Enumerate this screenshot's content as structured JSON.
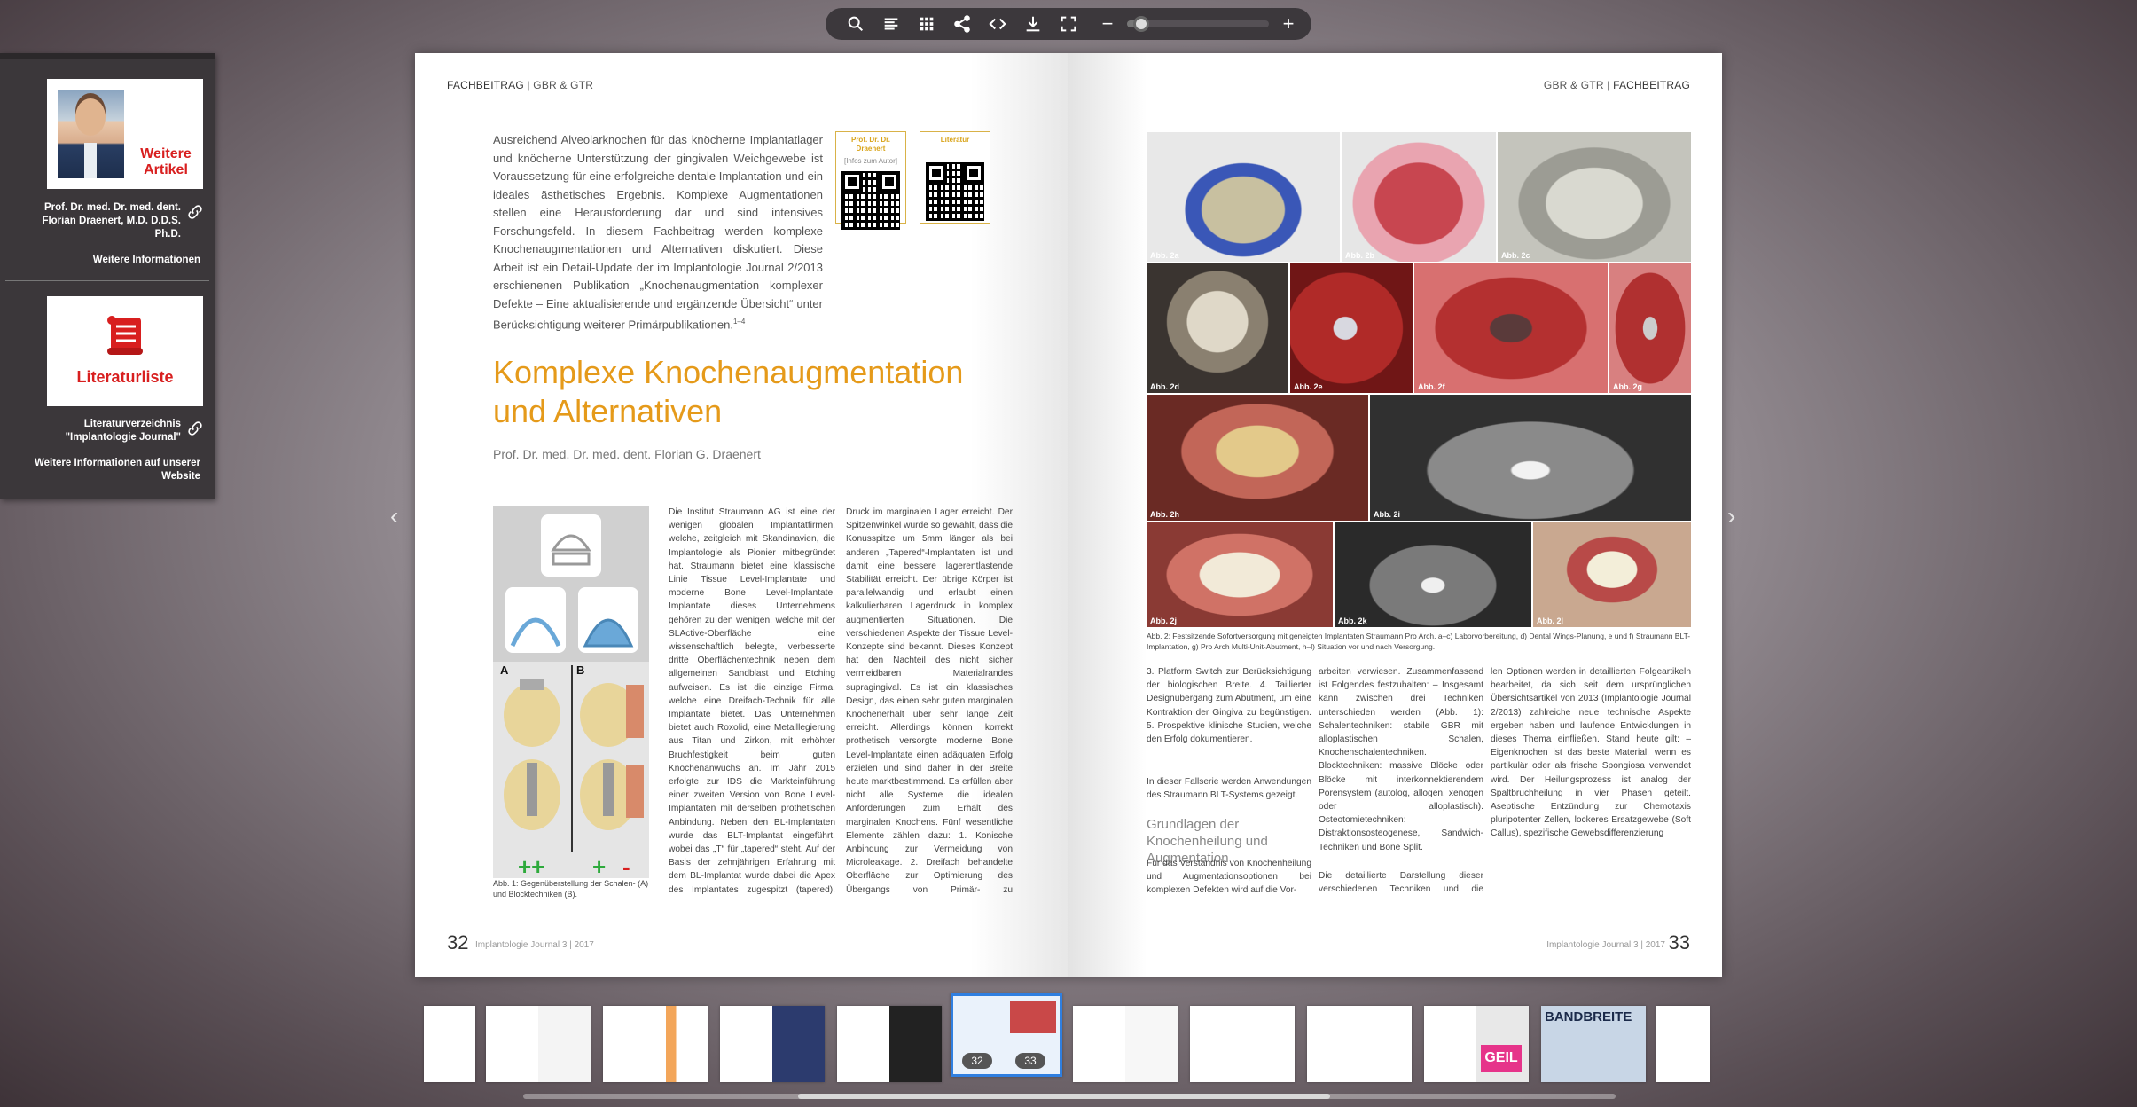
{
  "toolbar": {
    "icons": [
      "search-icon",
      "toc-icon",
      "grid-icon",
      "share-icon",
      "embed-icon",
      "download-icon",
      "fullscreen-icon"
    ],
    "zoom_minus": "−",
    "zoom_plus": "+",
    "zoom_level": 0.1
  },
  "sidebar": {
    "card1_title": "Weitere Artikel",
    "author_name": "Prof. Dr. med. Dr. med. dent. Florian Draenert, M.D. D.D.S. Ph.D.",
    "more_info": "Weitere Informationen",
    "card2_title": "Literaturliste",
    "lit_link": "Literaturverzeichnis \"Implantologie Journal\"",
    "website_link": "Weitere Informationen auf unserer Website"
  },
  "left_page": {
    "runhead_section": "FACHBEITRAG",
    "runhead_topic": "GBR & GTR",
    "intro": "Ausreichend Alveolarknochen für das knöcherne Implantatlager und knöcherne Unterstützung der gingivalen Weichgewebe ist Voraussetzung für eine erfolgreiche dentale Implantation und ein ideales ästhetisches Ergebnis. Komplexe Augmentationen stellen eine Herausforderung dar und sind intensives Forschungsfeld. In diesem Fachbeitrag werden komplexe Knochenaugmentationen und Alternativen diskutiert. Diese Arbeit ist ein Detail-Update der im Implantologie Journal 2/2013 erschienenen Publikation „Knochenaugmentation komplexer Defekte – Eine aktualisierende und ergänzende Übersicht“ unter Berücksichtigung weiterer Primärpublikationen.",
    "intro_ref": "1–4",
    "qr1_label": "Prof. Dr. Dr. Draenert",
    "qr1_sub": "[Infos zum Autor]",
    "qr2_label": "Literatur",
    "title": "Komplexe Knochenaugmentation und Alternativen",
    "author": "Prof. Dr. med. Dr. med. dent. Florian G. Draenert",
    "fig_label_a": "A",
    "fig_label_b": "B",
    "fig_plusplus": "++",
    "fig_plus": "+",
    "fig_minus": "-",
    "fig_caption": "Abb. 1: Gegenüberstellung der Schalen- (A) und Blocktechniken (B).",
    "col1": "Die Institut Straumann AG ist eine der wenigen globalen Implantatfirmen, welche, zeitgleich mit Skandinavien, die Implantologie als Pionier mitbegründet hat. Straumann bietet eine klassische Linie Tissue Level-Implantate und moderne Bone Level-Implantate. Implantate dieses Unternehmens gehören zu den wenigen, welche mit der SLActive-Oberfläche eine wissenschaftlich belegte, verbesserte dritte Oberflächentechnik neben dem allgemeinen Sandblast und Etching aufweisen. Es ist die einzige Firma, welche eine Dreifach-Technik für alle Implantate bietet. Das Unternehmen bietet auch Roxolid, eine Metalllegierung aus Titan und Zirkon, mit erhöhter Bruchfestigkeit beim guten Knochenanwuchs an. Im Jahr 2015 erfolgte zur IDS die Markteinführung einer zweiten Version von Bone Level-Implantaten mit derselben prothetischen Anbindung. Neben den BL-Implantaten wurde das BLT-Implantat eingeführt, wobei das „T“ für „tapered“ steht. Auf der Basis der zehnjährigen Erfahrung mit dem BL-Implantat wurde dabei die Apex des Implantates zugespitzt (tapered), was eine erhöhte Primärstabilität ohne erhöhten",
    "col2": "Druck im marginalen Lager erreicht. Der Spitzenwinkel wurde so gewählt, dass die Konusspitze um 5mm länger als bei anderen „Tapered“-Implantaten ist und damit eine bessere lagerentlastende Stabilität erreicht. Der übrige Körper ist parallelwandig und erlaubt einen kalkulierbaren Lagerdruck in komplex augmentierten Situationen. Die verschiedenen Aspekte der Tissue Level-Konzepte sind bekannt. Dieses Konzept hat den Nachteil des nicht sicher vermeidbaren Materialrandes supragingival. Es ist ein klassisches Design, das einen sehr guten marginalen Knochenerhalt über sehr lange Zeit erreicht. Allerdings können korrekt prothetisch versorgte moderne Bone Level-Implantate einen adäquaten Erfolg erzielen und sind daher in der Breite heute marktbestimmend. Es erfüllen aber nicht alle Systeme die idealen Anforderungen zum Erhalt des marginalen Knochens. Fünf wesentliche Elemente zählen dazu: 1. Konische Anbindung zur Vermeidung von Microleakage. 2. Dreifach behandelte Oberfläche zur Optimierung des Übergangs von Primär- zu Sekundärstabilität.",
    "page_number": "32",
    "footer": "Implantologie Journal 3 | 2017"
  },
  "right_page": {
    "runhead_topic": "GBR & GTR",
    "runhead_section": "FACHBEITRAG",
    "photos": [
      "Abb. 2a",
      "Abb. 2b",
      "Abb. 2c",
      "Abb. 2d",
      "Abb. 2e",
      "Abb. 2f",
      "Abb. 2g",
      "Abb. 2h",
      "Abb. 2i",
      "Abb. 2j",
      "Abb. 2k",
      "Abb. 2l"
    ],
    "fig_caption": "Abb. 2: Festsitzende Sofortversorgung mit geneigten Implantaten Straumann Pro Arch. a–c) Laborvorbereitung, d) Dental Wings-Planung, e und f) Straumann BLT-Implantation, g) Pro Arch Multi-Unit-Abutment, h–l) Situation vor und nach Versorgung.",
    "col1a": "3. Platform Switch zur Berücksichtigung der biologischen Breite. 4. Taillierter Designübergang zum Abutment, um eine Kontraktion der Gingiva zu begünstigen. 5. Prospektive klinische Studien, welche den Erfolg dokumentieren.",
    "col1b": "In dieser Fallserie werden Anwendungen des Straumann BLT-Systems gezeigt.",
    "subhead": "Grundlagen der Knochenheilung und Augmentation",
    "col1c": "Für das Verständnis von Knochenheilung und Augmentationsoptionen bei komplexen Defekten wird auf die Vor-",
    "col2a": "arbeiten verwiesen. Zusammenfassend ist Folgendes festzuhalten: – Insgesamt kann zwischen drei Techniken unterschieden werden (Abb. 1): Schalentechniken: stabile GBR mit alloplastischen Schalen, Knochenschalentechniken. Blocktechniken: massive Blöcke oder Blöcke mit interkonnektierendem Porensystem (autolog, allogen, xenogen oder alloplastisch). Osteotomietechniken: Distraktionsosteogenese, Sandwich-Techniken und Bone Split.",
    "col2b": "Die detaillierte Darstellung dieser verschiedenen Techniken und die sinnvol-",
    "col3": "len Optionen werden in detaillierten Folgeartikeln bearbeitet, da sich seit dem ursprünglichen Übersichtsartikel von 2013 (Implantologie Journal 2/2013) zahlreiche neue technische Aspekte ergeben haben und laufende Entwicklungen in dieses Thema einfließen. Stand heute gilt: – Eigenknochen ist das beste Material, wenn es partikulär oder als frische Spongiosa verwendet wird. Der Heilungsprozess ist analog der Spaltbruchheilung in vier Phasen geteilt. Aseptische Entzündung zur Chemotaxis pluripotenter Zellen, lockeres Ersatzgewebe (Soft Callus), spezifische Gewebsdifferenzierung",
    "page_number": "33",
    "footer": "Implantologie Journal 3 | 2017"
  },
  "thumbnails": {
    "active_left": "32",
    "active_right": "33",
    "banner1": "BANDBREITE",
    "banner2": "GEIL"
  }
}
